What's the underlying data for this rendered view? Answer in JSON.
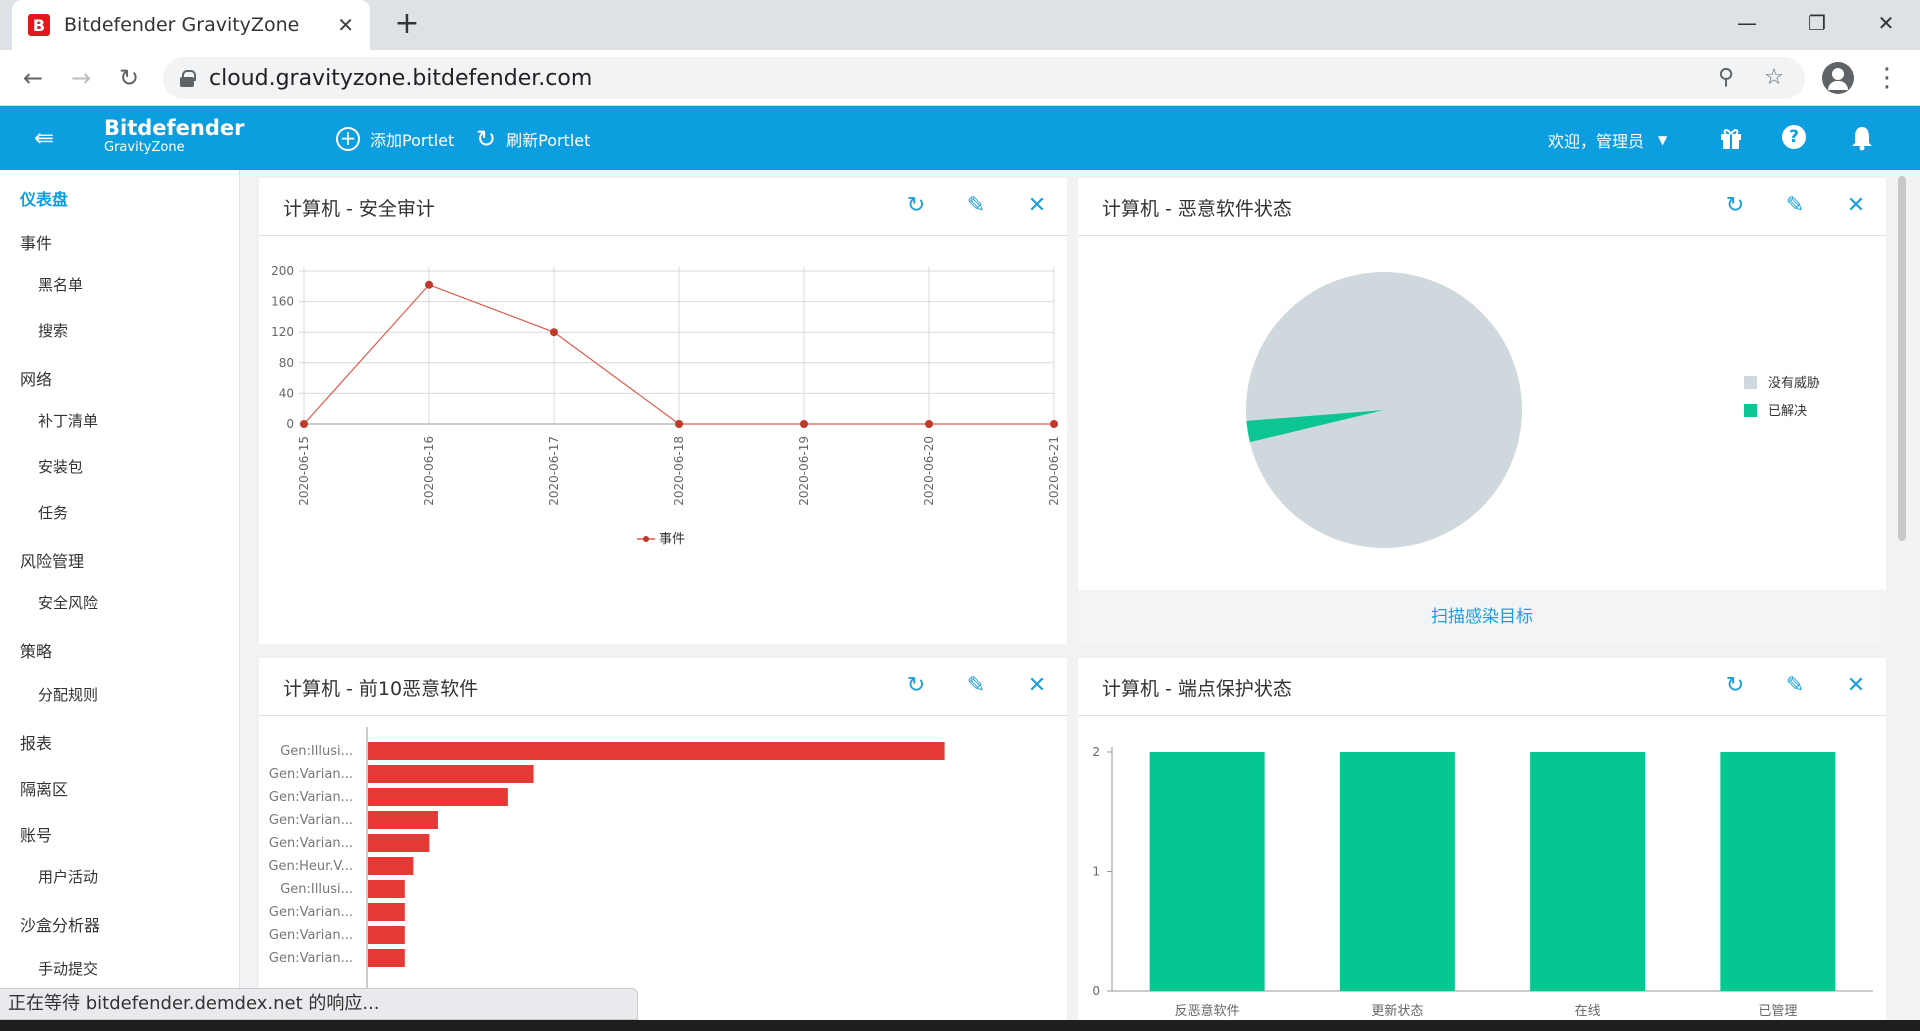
{
  "browser": {
    "tab_title": "Bitdefender GravityZone",
    "favicon_letter": "B",
    "url": "cloud.gravityzone.bitdefender.com",
    "status_text": "正在等待 bitdefender.demdex.net 的响应..."
  },
  "header": {
    "brand_name": "Bitdefender",
    "brand_sub": "GravityZone",
    "add_portlet": "添加Portlet",
    "refresh_portlet": "刷新Portlet",
    "welcome": "欢迎，管理员",
    "bg_color": "#0d9edf"
  },
  "sidebar": {
    "items": [
      {
        "label": "仪表盘",
        "active": true
      },
      {
        "label": "事件"
      },
      {
        "label": "黑名单",
        "sub": true
      },
      {
        "label": "搜索",
        "sub": true
      },
      {
        "label": "网络"
      },
      {
        "label": "补丁清单",
        "sub": true
      },
      {
        "label": "安装包",
        "sub": true
      },
      {
        "label": "任务",
        "sub": true
      },
      {
        "label": "风险管理"
      },
      {
        "label": "安全风险",
        "sub": true
      },
      {
        "label": "策略"
      },
      {
        "label": "分配规则",
        "sub": true
      },
      {
        "label": "报表"
      },
      {
        "label": "隔离区"
      },
      {
        "label": "账号"
      },
      {
        "label": "用户活动",
        "sub": true
      },
      {
        "label": "沙盒分析器"
      },
      {
        "label": "手动提交",
        "sub": true
      }
    ]
  },
  "portlets": {
    "audit": {
      "title": "计算机 - 安全审计"
    },
    "malware_status": {
      "title": "计算机 - 恶意软件状态",
      "footer": "扫描感染目标"
    },
    "top10": {
      "title": "计算机 - 前10恶意软件"
    },
    "endpoint": {
      "title": "计算机 - 端点保护状态"
    }
  },
  "chart_data": [
    {
      "type": "line",
      "x": [
        "2020-06-15",
        "2020-06-16",
        "2020-06-17",
        "2020-06-18",
        "2020-06-19",
        "2020-06-20",
        "2020-06-21"
      ],
      "series": [
        {
          "name": "事件",
          "values": [
            0,
            182,
            120,
            0,
            0,
            0,
            0
          ],
          "color": "#e05a4f"
        }
      ],
      "yticks": [
        0,
        40,
        80,
        120,
        160,
        200
      ],
      "ylim": [
        0,
        200
      ],
      "grid": true,
      "legend": "bottom"
    },
    {
      "type": "pie",
      "slices": [
        {
          "label": "没有威胁",
          "value": 97.5,
          "color": "#cfd8dc"
        },
        {
          "label": "已解决",
          "value": 2.5,
          "color": "#0cc593"
        }
      ],
      "legend": "right"
    },
    {
      "type": "bar",
      "orientation": "horizontal",
      "categories": [
        "Gen:Illusi...",
        "Gen:Varian...",
        "Gen:Varian...",
        "Gen:Varian...",
        "Gen:Varian...",
        "Gen:Heur.V...",
        "Gen:Illusi...",
        "Gen:Varian...",
        "Gen:Varian...",
        "Gen:Varian..."
      ],
      "values": [
        47,
        13.5,
        11.4,
        5.7,
        5,
        3.7,
        3,
        3,
        3,
        3
      ],
      "xlim": [
        0,
        56
      ],
      "color": "#e53935"
    },
    {
      "type": "bar",
      "categories": [
        "反恶意软件",
        "更新状态",
        "在线",
        "已管理"
      ],
      "values": [
        2,
        2,
        2,
        2
      ],
      "yticks": [
        0,
        1,
        2
      ],
      "ylim": [
        0,
        2
      ],
      "color": "#05c792"
    }
  ]
}
